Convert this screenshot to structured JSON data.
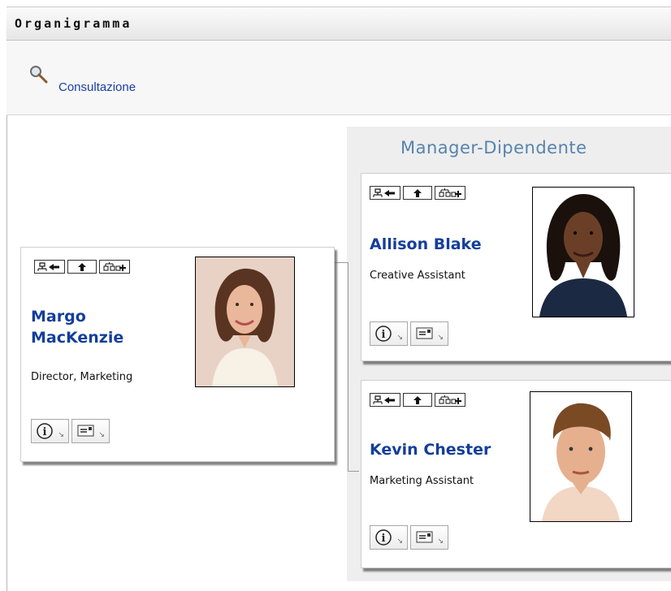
{
  "window": {
    "title": "Organigramma"
  },
  "toolbar": {
    "lookup_label": "Consultazione"
  },
  "panel": {
    "title": "Manager-Dipendente"
  },
  "manager": {
    "name": "Margo MacKenzie",
    "role": "Director, Marketing"
  },
  "reports": [
    {
      "name": "Allison Blake",
      "role": "Creative Assistant"
    },
    {
      "name": "Kevin Chester",
      "role": "Marketing Assistant"
    }
  ],
  "colors": {
    "accent": "#143e9b",
    "panel_title": "#5784ad",
    "link": "#1b3ea3"
  },
  "icons": {
    "nav": [
      "show-manager-icon",
      "go-up-icon",
      "show-reports-icon"
    ],
    "actions": [
      "info-icon",
      "email-icon"
    ]
  }
}
